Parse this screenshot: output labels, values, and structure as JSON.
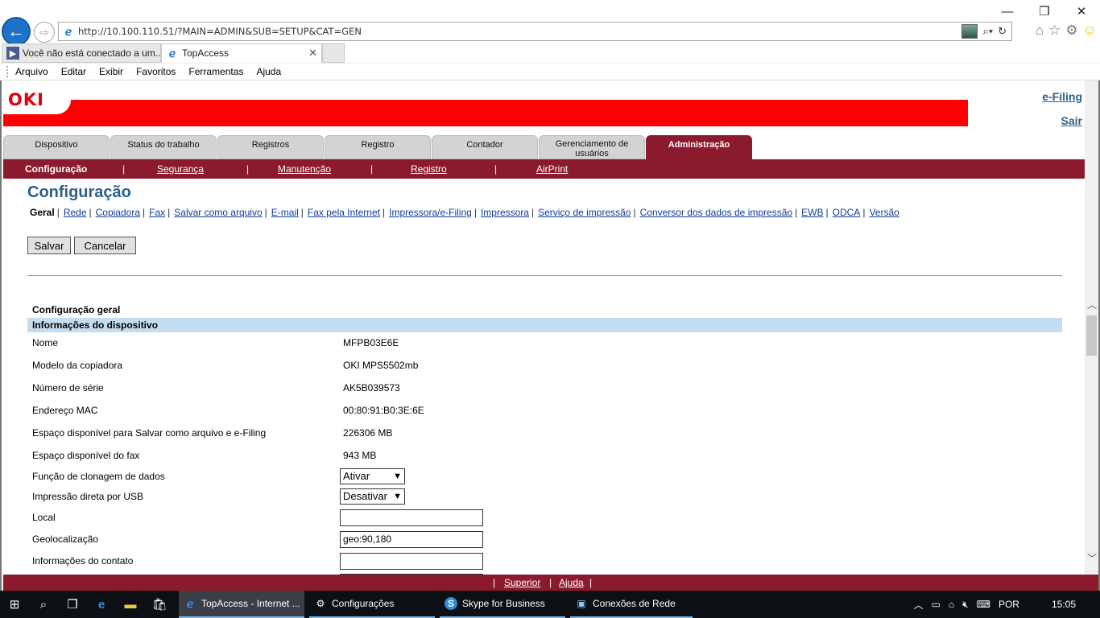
{
  "window": {
    "minimize": "—",
    "restore": "❐",
    "close": "✕"
  },
  "address": {
    "url": "http://10.100.110.51/?MAIN=ADMIN&SUB=SETUP&CAT=GEN"
  },
  "browser_tabs": [
    {
      "label": "Você não está conectado a um..."
    },
    {
      "label": "TopAccess"
    }
  ],
  "menubar": [
    "Arquivo",
    "Editar",
    "Exibir",
    "Favoritos",
    "Ferramentas",
    "Ajuda"
  ],
  "header": {
    "logo": "OKI",
    "efiling": "e-Filing",
    "sair": "Sair"
  },
  "main_tabs": [
    {
      "label": "Dispositivo"
    },
    {
      "label": "Status do trabalho"
    },
    {
      "label": "Registros"
    },
    {
      "label": "Registro"
    },
    {
      "label": "Contador"
    },
    {
      "label": "Gerenciamento de usuários"
    },
    {
      "label": "Administração"
    }
  ],
  "subnav": [
    {
      "label": "Configuração"
    },
    {
      "label": "Segurança"
    },
    {
      "label": "Manutenção"
    },
    {
      "label": "Registro"
    },
    {
      "label": "AirPrint"
    }
  ],
  "subnav_sep": "|",
  "page": {
    "title": "Configuração",
    "save": "Salvar",
    "cancel": "Cancelar"
  },
  "categories": [
    "Geral",
    "Rede",
    "Copiadora",
    "Fax",
    "Salvar como arquivo",
    "E-mail",
    "Fax pela Internet",
    "Impressora/e-Filing",
    "Impressora",
    "Serviço de impressão",
    "Conversor dos dados de impressão",
    "EWB",
    "ODCA",
    "Versão"
  ],
  "category_sep": "|",
  "section": {
    "title": "Configuração geral",
    "header": "Informações do dispositivo"
  },
  "rows": {
    "nome": {
      "label": "Nome",
      "value": "MFPB03E6E"
    },
    "modelo": {
      "label": "Modelo da copiadora",
      "value": "OKI MPS5502mb"
    },
    "serie": {
      "label": "Número de série",
      "value": "AK5B039573"
    },
    "mac": {
      "label": "Endereço MAC",
      "value": "00:80:91:B0:3E:6E"
    },
    "espaco_arquivo": {
      "label": "Espaço disponível para Salvar como arquivo e e-Filing",
      "value": "226306 MB"
    },
    "espaco_fax": {
      "label": "Espaço disponível do fax",
      "value": "943 MB"
    },
    "clonagem": {
      "label": "Função de clonagem de dados",
      "value": "Ativar"
    },
    "usb": {
      "label": "Impressão direta por USB",
      "value": "Desativar"
    },
    "local": {
      "label": "Local",
      "value": ""
    },
    "geo": {
      "label": "Geolocalização",
      "value": "geo:90,180"
    },
    "contato": {
      "label": "Informações do contato",
      "value": ""
    }
  },
  "footer": {
    "superior": "Superior",
    "ajuda": "Ajuda",
    "sep": "|"
  },
  "taskbar": {
    "apps": [
      {
        "label": "TopAccess - Internet ..."
      },
      {
        "label": "Configurações"
      },
      {
        "label": "Skype for Business"
      },
      {
        "label": "Conexões de Rede"
      }
    ],
    "lang": "POR",
    "time": "15:05"
  }
}
